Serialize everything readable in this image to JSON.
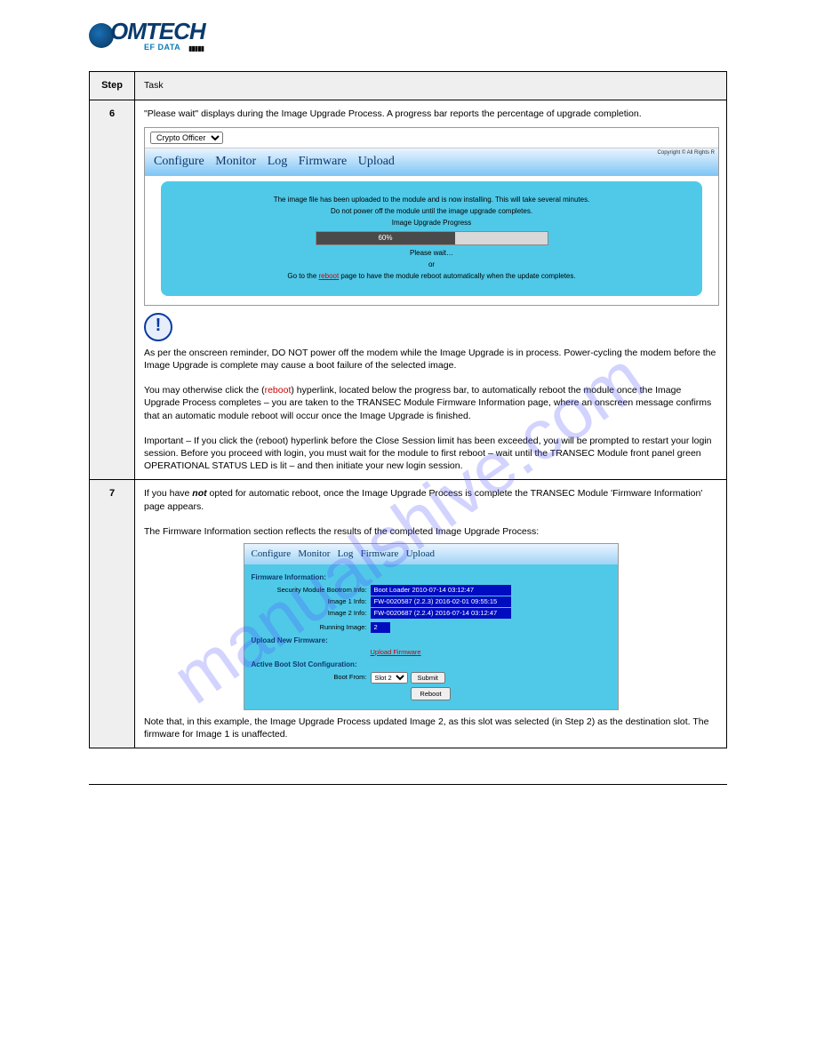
{
  "watermark": "manualshive.com",
  "logo": {
    "brand_main": "OMTECH",
    "brand_sub": "EF DATA",
    "brand_bars": "▮▮▮▮▮"
  },
  "header_row": {
    "step_col": "Step",
    "task_col": "Task"
  },
  "row6": {
    "num": "6",
    "intro": "\"Please wait\" displays during the Image Upgrade Process. A progress bar reports the percentage of upgrade completion.",
    "embed": {
      "role_select": "Crypto Officer",
      "nav": [
        "Configure",
        "Monitor",
        "Log",
        "Firmware",
        "Upload"
      ],
      "copyright": "Copyright ©\nAll Rights R",
      "panel_line1": "The image file has been uploaded to the module and is now installing. This will take several minutes.",
      "panel_line2": "Do not power off the module until the image upgrade completes.",
      "panel_header": "Image Upgrade Progress",
      "progress_pct": "60%",
      "panel_wait": "Please wait…",
      "panel_or": "or",
      "panel_reboot_text_pre": "Go to the ",
      "panel_reboot_link": "reboot",
      "panel_reboot_text_post": " page to have the module reboot automatically when the update completes."
    },
    "caution_lead": "As per the onscreen reminder, DO NOT power off the modem while the Image Upgrade is in process. Power-cycling the modem before the Image Upgrade is complete may cause a boot failure of the selected image.",
    "para2_pre": "You may otherwise click the (",
    "para2_link": "reboot",
    "para2_post": ") hyperlink, located below the progress bar, to automatically reboot the module once the Image Upgrade Process completes – you are taken to the TRANSEC Module Firmware Information page, where an onscreen message confirms that an automatic module reboot will occur once the Image Upgrade is finished.",
    "para3": "Important – If you click the (reboot) hyperlink before the Close Session limit has been exceeded, you will be prompted to restart your login session. Before you proceed with login, you must wait for the module to first reboot – wait until the TRANSEC Module front panel green OPERATIONAL STATUS LED is lit – and then initiate your new login session."
  },
  "row7": {
    "num": "7",
    "intro_pre": "If you have ",
    "intro_em": "not",
    "intro_post": " opted for automatic reboot, once the Image Upgrade Process is complete the TRANSEC Module 'Firmware Information' page appears.",
    "intro2": "The Firmware Information section reflects the results of the completed Image Upgrade Process:",
    "embed": {
      "nav": [
        "Configure",
        "Monitor",
        "Log",
        "Firmware",
        "Upload"
      ],
      "sec_firmware": "Firmware Information:",
      "bootrom_lbl": "Security Module Bootrom Info:",
      "bootrom_val": "Boot Loader 2010-07-14 03:12:47",
      "img1_lbl": "Image 1 Info:",
      "img1_val": "FW-0020587 (2.2.3) 2016-02-01 09:55:15",
      "img2_lbl": "Image 2 Info:",
      "img2_val": "FW-0020687 (2.2.4) 2016-07-14 03:12:47",
      "running_lbl": "Running Image:",
      "running_val": "2",
      "sec_upload": "Upload New Firmware:",
      "upload_link": "Upload Firmware",
      "sec_active": "Active Boot Slot Configuration:",
      "bootfrom_lbl": "Boot From:",
      "bootfrom_sel": "Slot 2",
      "submit_btn": "Submit",
      "reboot_btn": "Reboot"
    },
    "para_below": "Note that, in this example, the Image Upgrade Process updated Image 2, as this slot was selected (in Step 2) as the destination slot. The firmware for Image 1 is unaffected."
  }
}
